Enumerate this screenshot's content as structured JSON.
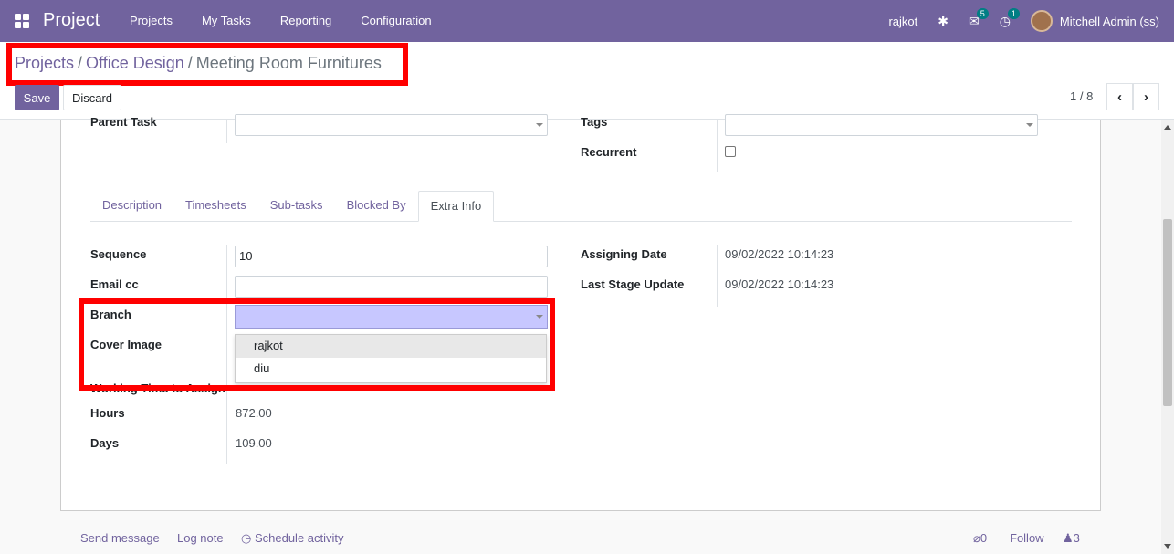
{
  "navbar": {
    "brand": "Project",
    "menu": [
      "Projects",
      "My Tasks",
      "Reporting",
      "Configuration"
    ],
    "company": "rajkot",
    "messages_count": "5",
    "activities_count": "1",
    "user": "Mitchell Admin (ss)",
    "color": "#71639e"
  },
  "breadcrumb": {
    "projects": "Projects",
    "sep": "/",
    "project": "Office Design",
    "current": "Meeting Room Furnitures"
  },
  "buttons": {
    "save": "Save",
    "discard": "Discard"
  },
  "pager": {
    "text": "1 / 8",
    "prev": "‹",
    "next": "›"
  },
  "form": {
    "parent_task_label": "Parent Task",
    "tags_label": "Tags",
    "recurrent_label": "Recurrent",
    "tabs": [
      "Description",
      "Timesheets",
      "Sub-tasks",
      "Blocked By",
      "Extra Info"
    ],
    "sequence_label": "Sequence",
    "sequence_value": "10",
    "email_cc_label": "Email cc",
    "branch_label": "Branch",
    "branch_options": [
      "rajkot",
      "diu"
    ],
    "cover_image_label": "Cover Image",
    "working_time_label": "Working Time to Assign",
    "hours_label": "Hours",
    "hours_value": "872.00",
    "days_label": "Days",
    "days_value": "109.00",
    "assigning_date_label": "Assigning Date",
    "assigning_date_value": "09/02/2022 10:14:23",
    "last_stage_update_label": "Last Stage Update",
    "last_stage_update_value": "09/02/2022 10:14:23"
  },
  "chatter": {
    "send_message": "Send message",
    "log_note": "Log note",
    "schedule_activity": "Schedule activity",
    "attachments": "0",
    "follow": "Follow",
    "followers": "3"
  }
}
